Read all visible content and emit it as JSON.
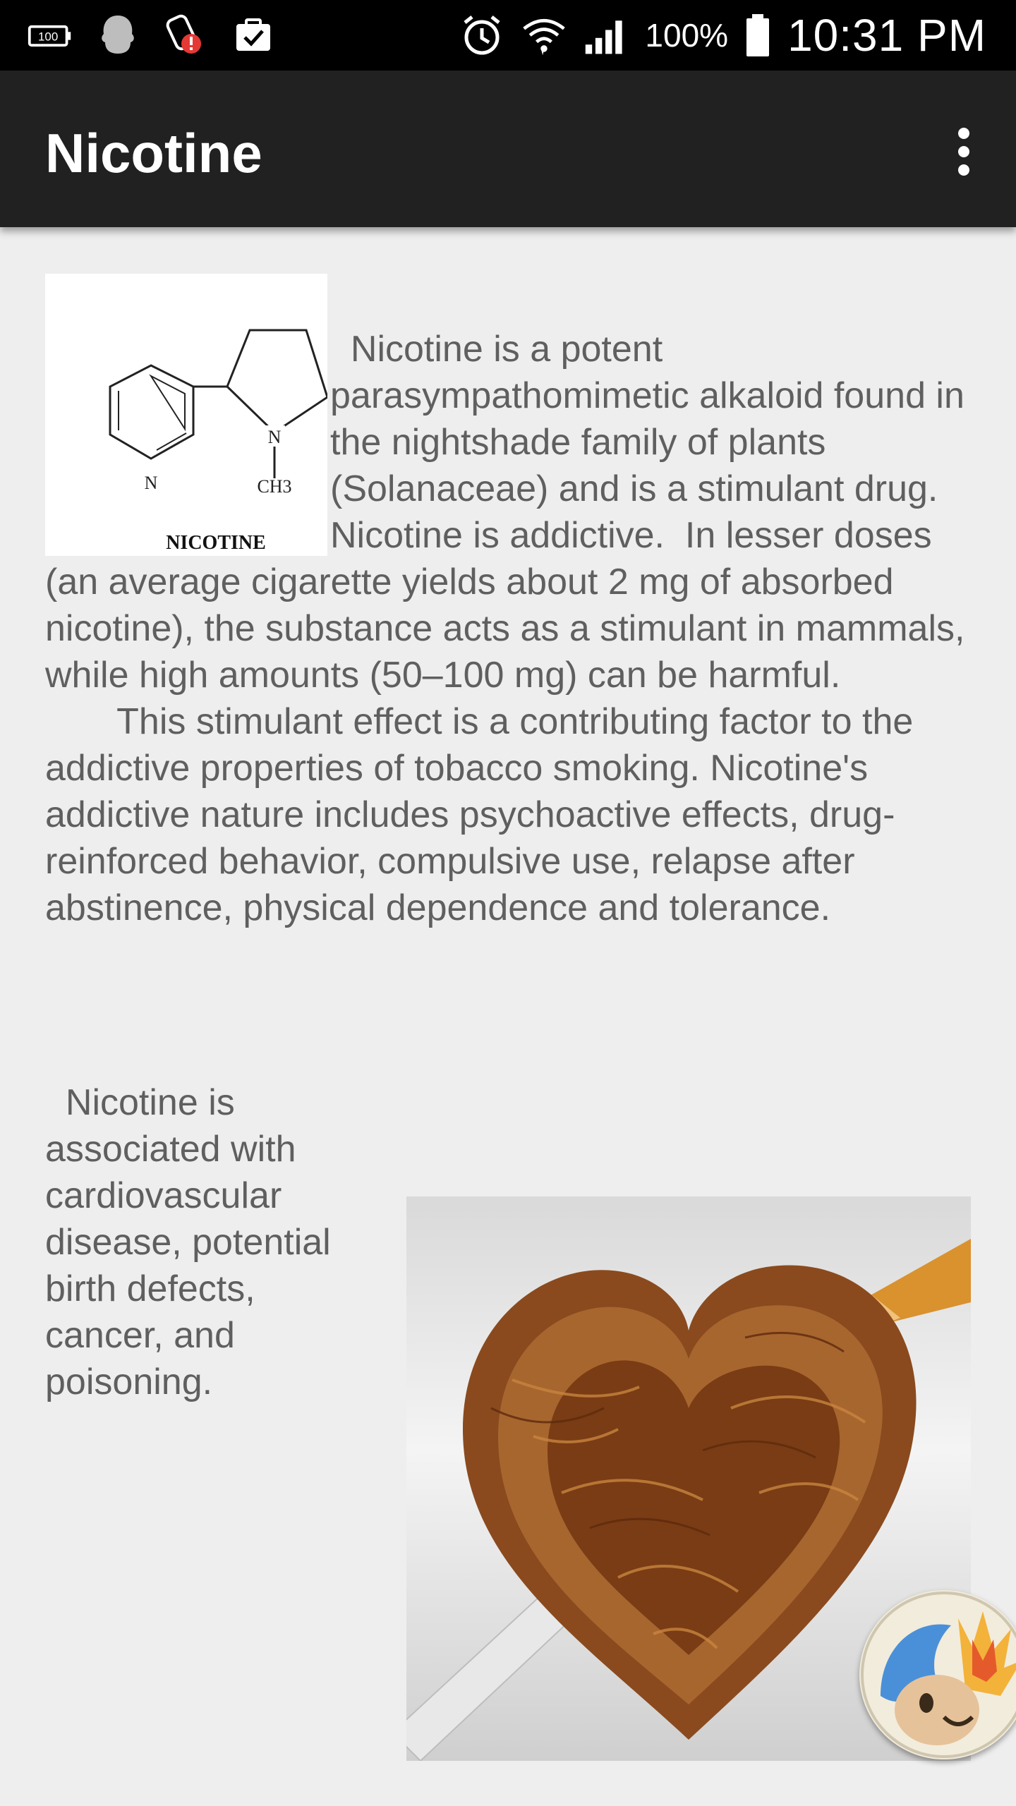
{
  "status_bar": {
    "icons_left": [
      "battery-100-notification-icon",
      "ghost-app-icon",
      "alert-app-icon",
      "clipboard-check-icon"
    ],
    "icons_right": [
      "alarm-icon",
      "wifi-icon",
      "signal-icon"
    ],
    "battery_percent": "100%",
    "time": "10:31 PM"
  },
  "app_bar": {
    "title": "Nicotine",
    "menu_icon": "more-vert-icon"
  },
  "structure_image": {
    "label_n": "N",
    "label_nh": "N",
    "label_ch3": "CH3",
    "caption": "NICOTINE"
  },
  "content": {
    "paragraph1": "  Nicotine is a potent parasympathomimetic alkaloid found in the nightshade family of plants (Solanaceae) and is a stimulant drug. Nicotine is addictive.  In lesser doses (an average cigarette yields about 2 mg of absorbed nicotine), the substance acts as a stimulant in mammals, while high amounts (50–100 mg) can be harmful.        This stimulant effect is a contributing factor to the addictive properties of tobacco smoking. Nicotine's addictive nature includes psychoactive effects, drug-reinforced behavior, compulsive use, relapse after abstinence, physical dependence and tolerance.",
    "paragraph2": "  Nicotine is associated with cardiovascular disease, potential birth defects, cancer, and poisoning."
  },
  "colors": {
    "status_bar_bg": "#000000",
    "app_bar_bg": "#212121",
    "page_bg": "#eeeeee",
    "body_text": "#5f5f5f"
  }
}
